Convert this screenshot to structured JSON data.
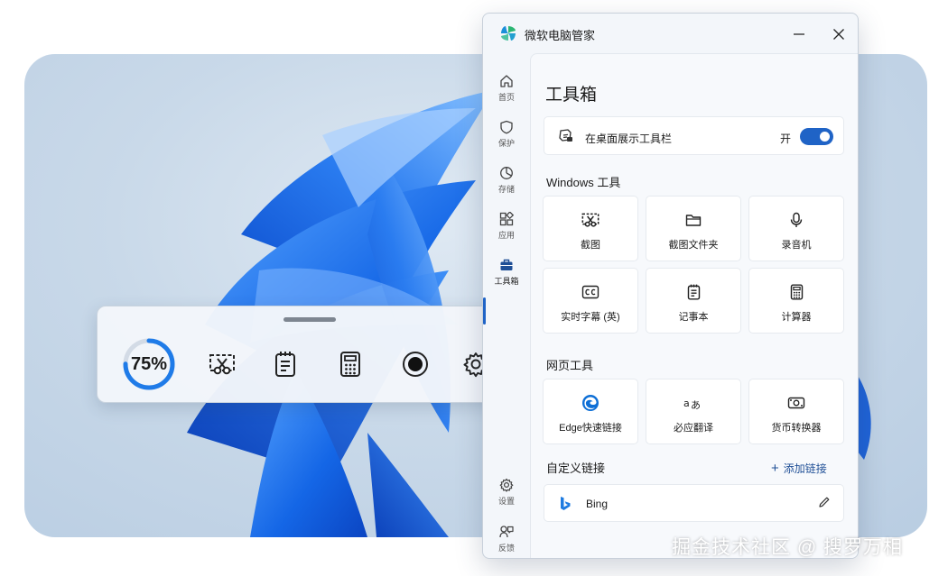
{
  "toolbar": {
    "progress_text": "75%",
    "progress_value": 0.75,
    "buttons": [
      "screenshot-icon",
      "notepad-icon",
      "calculator-icon",
      "record-icon",
      "gear-icon"
    ]
  },
  "window": {
    "title": "微软电脑管家",
    "nav": [
      {
        "label": "首页",
        "icon": "home-icon"
      },
      {
        "label": "保护",
        "icon": "shield-icon"
      },
      {
        "label": "存储",
        "icon": "pie-chart-icon"
      },
      {
        "label": "应用",
        "icon": "apps-icon"
      },
      {
        "label": "工具箱",
        "icon": "toolbox-icon",
        "active": true
      },
      {
        "label": "设置",
        "icon": "gear-icon"
      },
      {
        "label": "反馈",
        "icon": "feedback-icon"
      }
    ],
    "page_title": "工具箱",
    "show_toolbar": {
      "label": "在桌面展示工具栏",
      "state": "开",
      "enabled": true
    },
    "windows_tools": {
      "title": "Windows 工具",
      "items": [
        {
          "label": "截图",
          "icon": "screenshot-icon"
        },
        {
          "label": "截图文件夹",
          "icon": "folder-icon"
        },
        {
          "label": "录音机",
          "icon": "microphone-icon"
        },
        {
          "label": "实时字幕 (英)",
          "icon": "captions-icon"
        },
        {
          "label": "记事本",
          "icon": "notepad-icon"
        },
        {
          "label": "计算器",
          "icon": "calculator-icon"
        }
      ]
    },
    "web_tools": {
      "title": "网页工具",
      "items": [
        {
          "label": "Edge快速链接",
          "icon": "edge-icon"
        },
        {
          "label": "必应翻译",
          "icon": "translate-icon"
        },
        {
          "label": "货币转换器",
          "icon": "currency-icon"
        }
      ]
    },
    "custom_links": {
      "title": "自定义链接",
      "add_label": "添加链接",
      "items": [
        {
          "label": "Bing",
          "icon": "bing-icon"
        }
      ]
    }
  },
  "watermark": "掘金技术社区 @ 搜罗万相",
  "colors": {
    "accent": "#1f63c6",
    "wallpaper_blue": "#1a6fe8"
  }
}
